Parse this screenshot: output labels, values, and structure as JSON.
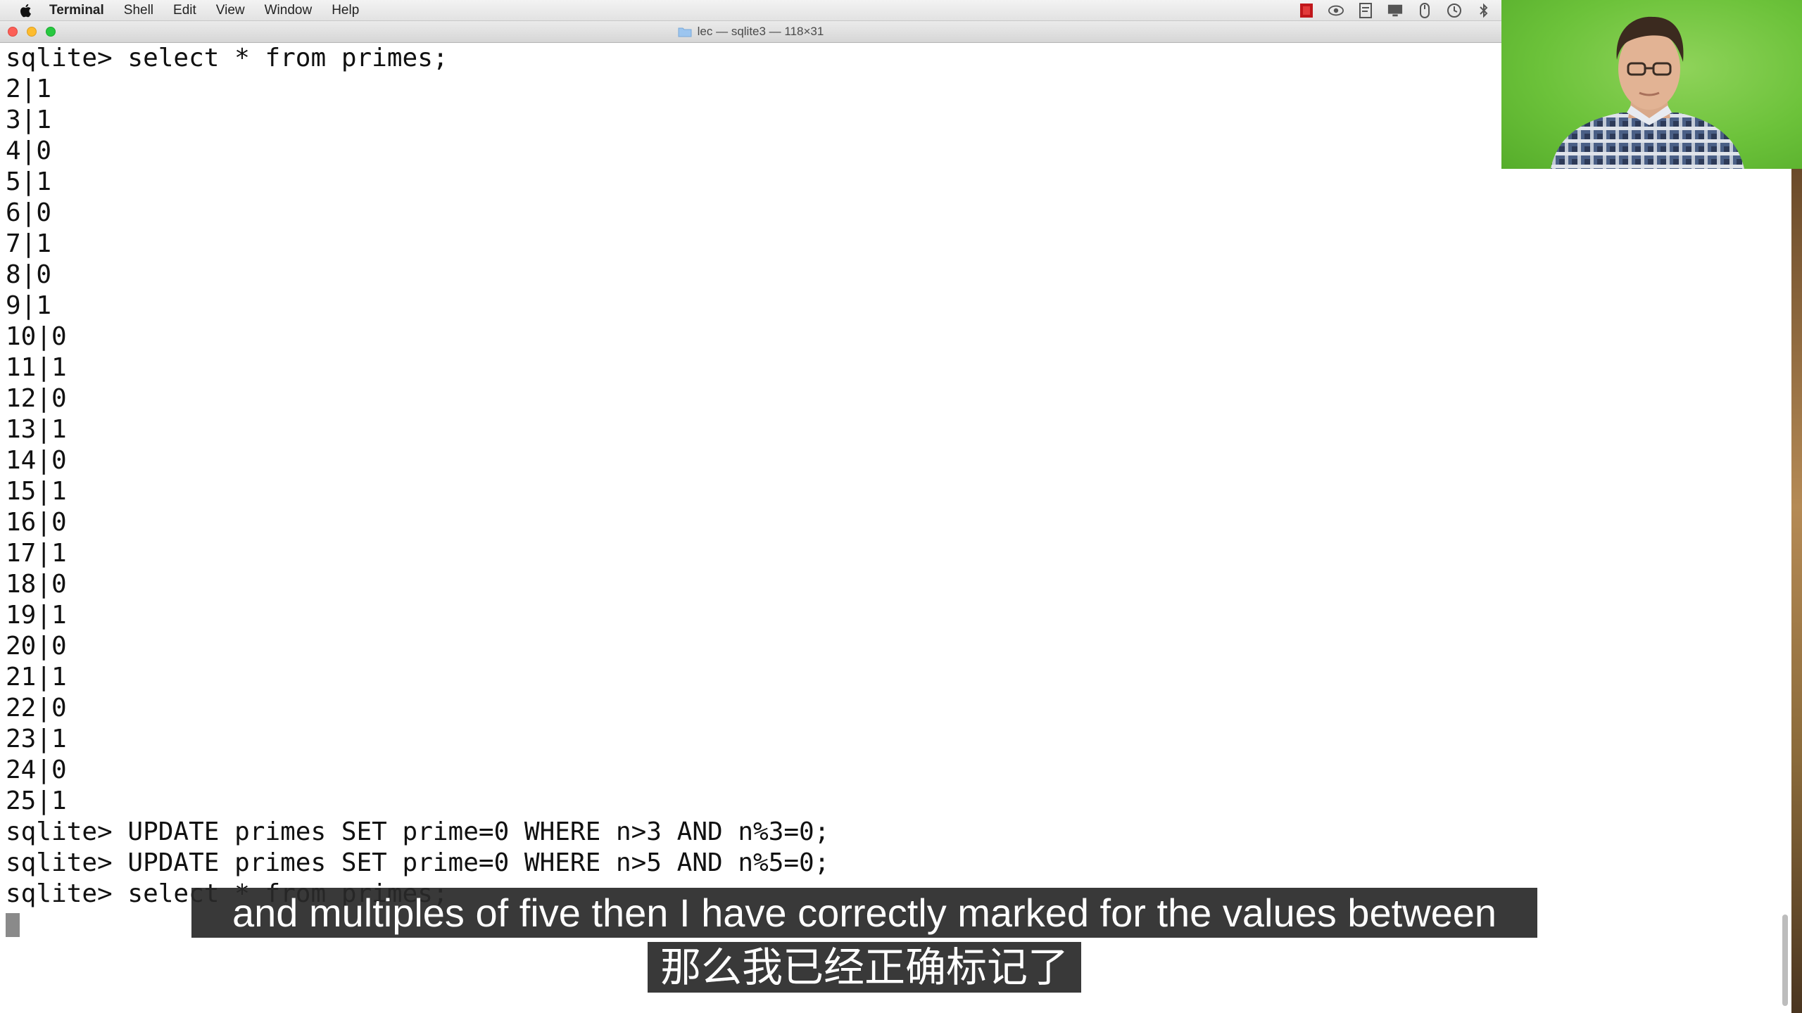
{
  "menubar": {
    "app_name": "Terminal",
    "items": [
      "Shell",
      "Edit",
      "View",
      "Window",
      "Help"
    ],
    "status_icons": [
      "record-icon",
      "eye-icon",
      "notes-icon",
      "display-icon",
      "mouse-icon",
      "time-machine-icon",
      "bluetooth-icon"
    ]
  },
  "window": {
    "title": "lec — sqlite3 — 118×31",
    "traffic_lights": [
      "close",
      "minimize",
      "maximize"
    ]
  },
  "terminal": {
    "lines": [
      "sqlite> select * from primes;",
      "2|1",
      "3|1",
      "4|0",
      "5|1",
      "6|0",
      "7|1",
      "8|0",
      "9|1",
      "10|0",
      "11|1",
      "12|0",
      "13|1",
      "14|0",
      "15|1",
      "16|0",
      "17|1",
      "18|0",
      "19|1",
      "20|0",
      "21|1",
      "22|0",
      "23|1",
      "24|0",
      "25|1",
      "sqlite> UPDATE primes SET prime=0 WHERE n>3 AND n%3=0;",
      "sqlite> UPDATE primes SET prime=0 WHERE n>5 AND n%5=0;",
      "sqlite> select * from primes;"
    ]
  },
  "subtitles": {
    "english": "and multiples of five then I have correctly marked for the values between",
    "chinese": "那么我已经正确标记了"
  },
  "colors": {
    "terminal_background": "#ffffff",
    "terminal_text": "#111111",
    "subtitle_background": "#282828",
    "webcam_background": "#6cc23a"
  }
}
